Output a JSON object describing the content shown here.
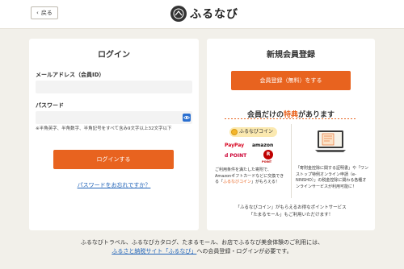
{
  "header": {
    "back_label": "戻る",
    "logo_text": "ふるなび",
    "logo_mark_text": "ふるなび"
  },
  "login": {
    "title": "ログイン",
    "email_label": "メールアドレス（会員ID）",
    "email_value": "",
    "password_label": "パスワード",
    "password_value": "",
    "password_hint": "※半角英字、半角数字、半角記号をすべて含み9文字以上32文字以下",
    "submit_label": "ログインする",
    "forgot_label": "パスワードをお忘れですか？"
  },
  "register": {
    "title": "新規会員登録",
    "button_label": "会員登録（無料）をする",
    "perk_heading_pre": "会員だけの",
    "perk_heading_hl": "特典",
    "perk_heading_post": "があります",
    "coin_badge": "ふるなびコイン",
    "brands": {
      "paypay": "PayPay",
      "amazon": "amazon",
      "rakuten": "R",
      "rakuten_sub": "POINT",
      "dpoint": "d POINT"
    },
    "perk_left_pre": "ご利用条件を満たした寄附で、Amazonギフトカードなどに交換できる「",
    "perk_left_hl": "ふるなびコイン",
    "perk_left_post": "」がもらえる！",
    "perk_right": "「寄附金控除に関する証明書」や「ワンストップ特例オンライン申請（e-NINSHO）」の税金控除に関わる各種オンラインサービスが利用可能に！",
    "footer_line1": "「ふるなびコイン」がもらえるお得なポイントサービス",
    "footer_line2": "「たまるモール」もご利用いただけます！"
  },
  "bottom": {
    "line1": "ふるなびトラベル、ふるなびカタログ、たまるモール、お店でふるなび美食体験のご利用には、",
    "link_text": "ふるさと納税サイト「ふるなび」",
    "line2_post": "への会員登録・ログインが必要です。"
  },
  "colors": {
    "accent": "#e8631f",
    "link": "#2264b8",
    "background": "#f2f0ea"
  }
}
